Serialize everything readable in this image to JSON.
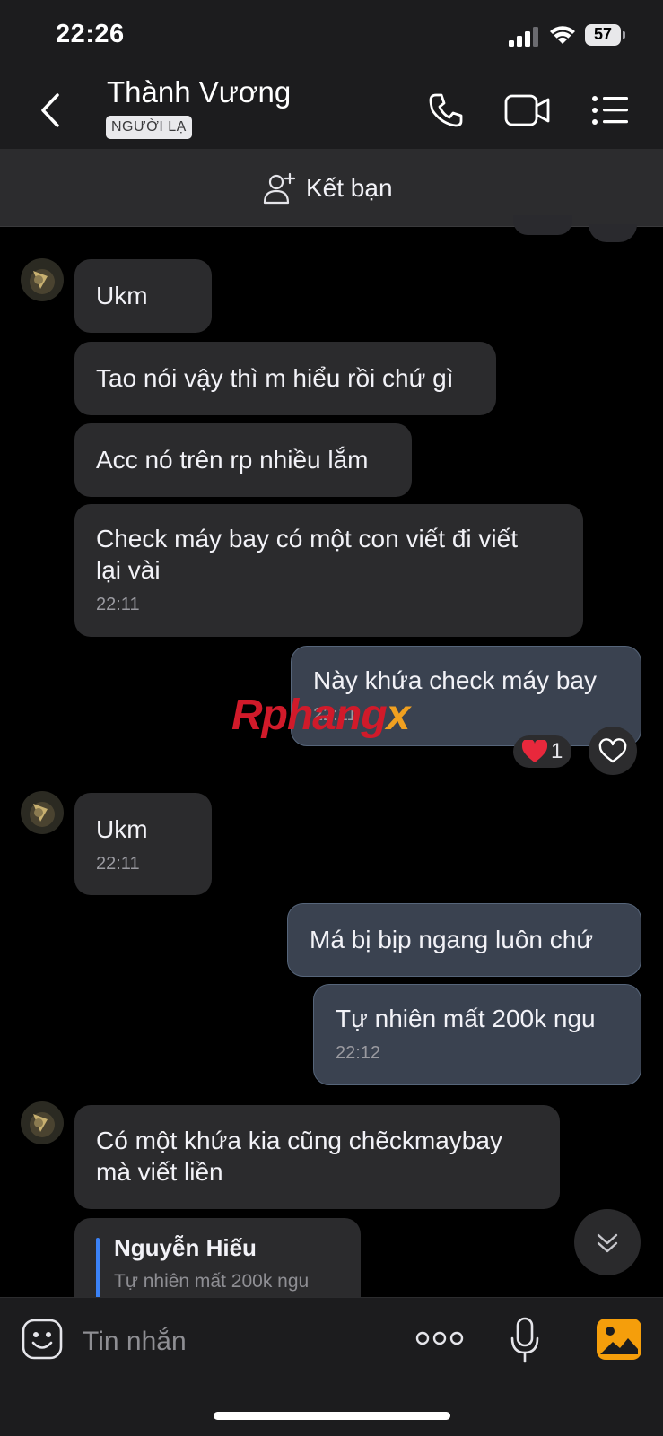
{
  "status_bar": {
    "time": "22:26",
    "battery": "57"
  },
  "header": {
    "contact_name": "Thành Vương",
    "badge": "NGƯỜI LẠ"
  },
  "add_friend": {
    "label": "Kết bạn"
  },
  "messages": [
    {
      "from": "contact",
      "text": "Ukm"
    },
    {
      "from": "contact",
      "text": "Tao nói vậy thì m hiểu rồi chứ gì"
    },
    {
      "from": "contact",
      "text": "Acc nó trên rp nhiều lắm"
    },
    {
      "from": "contact",
      "text_line1": "Check máy bay có một con viết đi viết",
      "text_line2": "lại vài",
      "time": "22:11"
    },
    {
      "from": "me",
      "text": "Này khứa check máy bay",
      "time": "22:11",
      "reaction": {
        "emoji": "❤️",
        "count": "1"
      }
    },
    {
      "from": "contact",
      "text": "Ukm",
      "time": "22:11"
    },
    {
      "from": "me",
      "text": "Má bị bịp ngang luôn chứ"
    },
    {
      "from": "me",
      "text": "Tự nhiên mất 200k ngu",
      "time": "22:12"
    },
    {
      "from": "contact",
      "text_line1": "Có một khứa kia cũng chẽckmaybay",
      "text_line2": "mà viết liền"
    },
    {
      "from": "contact",
      "type": "reply",
      "quoted_name": "Nguyễn Hiếu",
      "quoted_text": "Tự nhiên mất 200k ngu"
    }
  ],
  "watermark": {
    "part1": "Rphang",
    "part2": "x"
  },
  "composer": {
    "placeholder": "Tin nhắn"
  },
  "colors": {
    "accent_blue": "#3b82f6",
    "outgoing_bubble": "#3a4250",
    "incoming_bubble": "#2b2b2d",
    "gallery_orange": "#f59e0b"
  }
}
